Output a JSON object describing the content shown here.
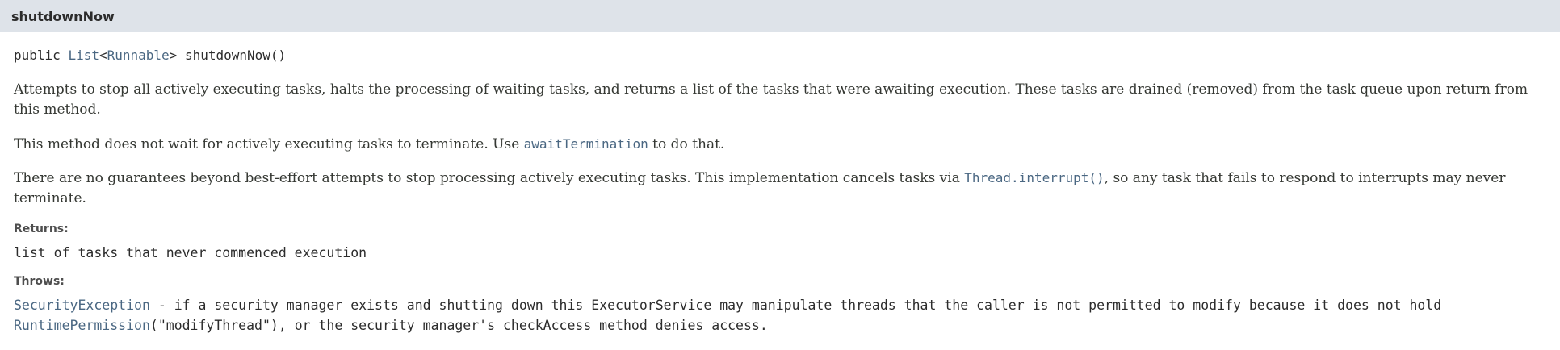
{
  "header": {
    "method_name": "shutdownNow"
  },
  "signature": {
    "modifier": "public",
    "return_type_link": "List",
    "type_open": "<",
    "type_param_link": "Runnable",
    "type_close": ">",
    "method": "shutdownNow()"
  },
  "description": {
    "p1": "Attempts to stop all actively executing tasks, halts the processing of waiting tasks, and returns a list of the tasks that were awaiting execution. These tasks are drained (removed) from the task queue upon return from this method.",
    "p2_before": "This method does not wait for actively executing tasks to terminate. Use ",
    "p2_link": "awaitTermination",
    "p2_after": " to do that.",
    "p3_before": "There are no guarantees beyond best-effort attempts to stop processing actively executing tasks. This implementation cancels tasks via ",
    "p3_link": "Thread.interrupt()",
    "p3_after": ", so any task that fails to respond to interrupts may never terminate."
  },
  "returns": {
    "label": "Returns:",
    "value": "list of tasks that never commenced execution"
  },
  "throws": {
    "label": "Throws:",
    "exception_link": "SecurityException",
    "text_before": " - if a security manager exists and shutting down this ExecutorService may manipulate threads that the caller is not permitted to modify because it does not hold ",
    "permission_link": "RuntimePermission",
    "text_after": "(\"modifyThread\"), or the security manager's checkAccess method denies access."
  }
}
